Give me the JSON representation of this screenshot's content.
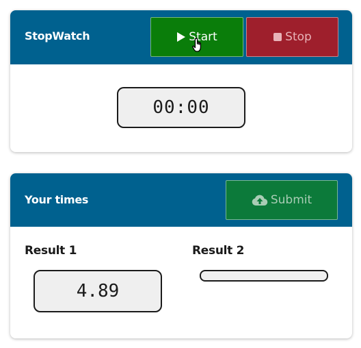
{
  "stopwatch": {
    "title": "StopWatch",
    "start_label": "Start",
    "stop_label": "Stop",
    "start_icon": "play-icon",
    "stop_icon": "stop-icon",
    "display": "00:00"
  },
  "times": {
    "title": "Your times",
    "submit_label": "Submit",
    "submit_icon": "cloud-upload-icon",
    "results": [
      {
        "label": "Result 1",
        "value": "4.89"
      },
      {
        "label": "Result 2",
        "value": ""
      }
    ]
  },
  "colors": {
    "header": "#00618f",
    "start": "#0a7d0a",
    "stop": "#9e1f2c",
    "submit": "#0c7a3a"
  }
}
